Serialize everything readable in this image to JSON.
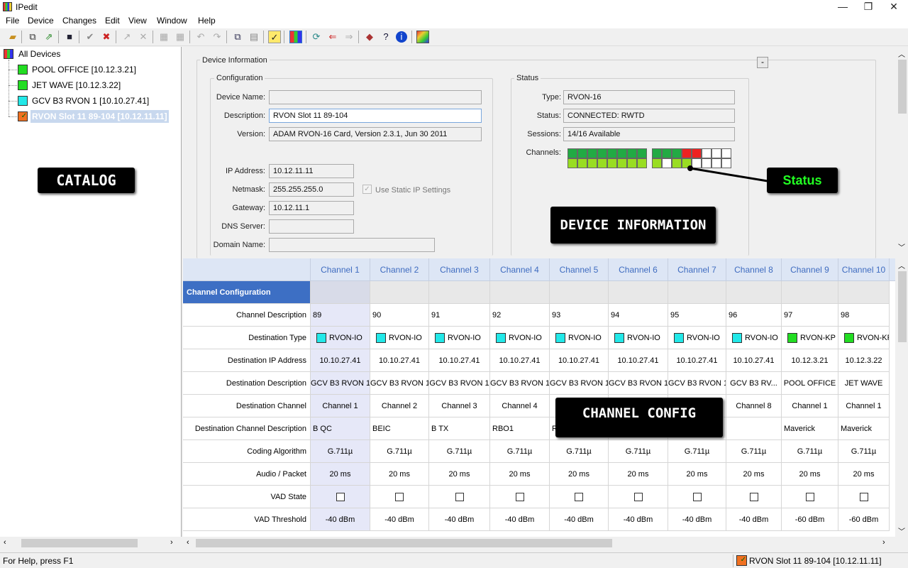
{
  "window": {
    "title": "IPedit",
    "minimize": "—",
    "restore": "❐",
    "close": "✕"
  },
  "menu": [
    "File",
    "Device",
    "Changes",
    "Edit",
    "View",
    "Window",
    "Help"
  ],
  "toolbar_icons": [
    "open-folder-icon",
    "copy-device-icon",
    "export-icon",
    "save-icon",
    "apply-icon",
    "cancel-changes-icon",
    "connect-icon",
    "disconnect-icon",
    "grid-a-icon",
    "grid-b-icon",
    "undo-icon",
    "redo-icon",
    "copy-icon",
    "paste-icon",
    "check-icon",
    "channel-grid-icon",
    "refresh-icon",
    "back-icon",
    "forward-icon",
    "book-icon",
    "help-cursor-icon",
    "info-icon",
    "palette-icon"
  ],
  "tree": {
    "root": "All Devices",
    "items": [
      {
        "label": "POOL OFFICE [10.12.3.21]",
        "color": "#22dd22"
      },
      {
        "label": "JET WAVE [10.12.3.22]",
        "color": "#22dd22"
      },
      {
        "label": "GCV B3 RVON 1 [10.10.27.41]",
        "color": "#22e8e8"
      },
      {
        "label": "RVON Slot 11  89-104 [10.12.11.11]",
        "color": "#f07020",
        "selected": true
      }
    ]
  },
  "callouts": {
    "catalog": "CATALOG",
    "device_info": "DEVICE INFORMATION",
    "status": "Status",
    "channel_config": "CHANNEL CONFIG"
  },
  "device_info": {
    "title": "Device Information",
    "collapse_btn": "-",
    "configuration": {
      "title": "Configuration",
      "device_name_label": "Device Name:",
      "device_name": "",
      "description_label": "Description:",
      "description": "RVON Slot 11  89-104",
      "version_label": "Version:",
      "version": "ADAM RVON-16 Card, Version 2.3.1, Jun 30 2011",
      "ip_label": "IP Address:",
      "ip": "10.12.11.11",
      "netmask_label": "Netmask:",
      "netmask": "255.255.255.0",
      "static_ip_label": "Use Static IP Settings",
      "gateway_label": "Gateway:",
      "gateway": "10.12.11.1",
      "dns_label": "DNS Server:",
      "dns": "",
      "domain_label": "Domain Name:",
      "domain": ""
    },
    "status": {
      "title": "Status",
      "type_label": "Type:",
      "type": "RVON-16",
      "status_label": "Status:",
      "status": "CONNECTED: RWTD",
      "sessions_label": "Sessions:",
      "sessions": "14/16 Available",
      "channels_label": "Channels:",
      "channels_top": [
        "#22aa44",
        "#22aa44",
        "#22aa44",
        "#22aa44",
        "#22aa44",
        "#22aa44",
        "#22aa44",
        "#22aa44",
        "#22aa44",
        "#22aa44",
        "#22aa44",
        "#ee2222",
        "#ee2222",
        "#ffffff",
        "#ffffff",
        "#ffffff",
        "#ffffff",
        "#ffffff",
        "#ffffff"
      ],
      "channels_bottom": [
        "#99dd22",
        "#99dd22",
        "#99dd22",
        "#99dd22",
        "#99dd22",
        "#99dd22",
        "#99dd22",
        "#99dd22",
        "#99dd22",
        "#ffffff",
        "#99dd22",
        "#99dd22",
        "#ffffff",
        "#ffffff",
        "#ffffff",
        "#ffffff",
        "#ffffff",
        "#ffffff",
        "#ffffff"
      ]
    }
  },
  "grid": {
    "section_label": "Channel Configuration",
    "columns": [
      "Channel 1",
      "Channel 2",
      "Channel 3",
      "Channel 4",
      "Channel 5",
      "Channel 6",
      "Channel 7",
      "Channel 8",
      "Channel 9",
      "Channel 10"
    ],
    "rows": [
      {
        "label": "Channel Description",
        "align": "l",
        "values": [
          "89",
          "90",
          "91",
          "92",
          "93",
          "94",
          "95",
          "96",
          "97",
          "98"
        ]
      },
      {
        "label": "Destination Type",
        "type": "dest",
        "values": [
          "RVON-IO",
          "RVON-IO",
          "RVON-IO",
          "RVON-IO",
          "RVON-IO",
          "RVON-IO",
          "RVON-IO",
          "RVON-IO",
          "RVON-KP",
          "RVON-KP"
        ],
        "colors": [
          "#22e8e8",
          "#22e8e8",
          "#22e8e8",
          "#22e8e8",
          "#22e8e8",
          "#22e8e8",
          "#22e8e8",
          "#22e8e8",
          "#22dd22",
          "#22dd22"
        ]
      },
      {
        "label": "Destination IP Address",
        "align": "c",
        "values": [
          "10.10.27.41",
          "10.10.27.41",
          "10.10.27.41",
          "10.10.27.41",
          "10.10.27.41",
          "10.10.27.41",
          "10.10.27.41",
          "10.10.27.41",
          "10.12.3.21",
          "10.12.3.22"
        ]
      },
      {
        "label": "Destination Description",
        "align": "c",
        "values": [
          "GCV B3 RVON 1",
          "GCV B3 RVON 1",
          "GCV B3 RVON 1",
          "GCV B3 RVON 1",
          "GCV B3 RVON 1",
          "GCV B3 RVON 1",
          "GCV B3 RVON 1",
          "GCV B3 RV...",
          "POOL OFFICE",
          "JET WAVE"
        ]
      },
      {
        "label": "Destination Channel",
        "align": "c",
        "values": [
          "Channel 1",
          "Channel 2",
          "Channel 3",
          "Channel 4",
          "",
          "",
          "",
          "Channel 8",
          "Channel 1",
          "Channel 1"
        ]
      },
      {
        "label": "Destination Channel Description",
        "align": "l",
        "values": [
          "B QC",
          "BEIC",
          "B TX",
          "RBO1",
          "R",
          "",
          "",
          "",
          "Maverick",
          "Maverick"
        ]
      },
      {
        "label": "Coding Algorithm",
        "align": "c",
        "values": [
          "G.711µ",
          "G.711µ",
          "G.711µ",
          "G.711µ",
          "G.711µ",
          "G.711µ",
          "G.711µ",
          "G.711µ",
          "G.711µ",
          "G.711µ"
        ]
      },
      {
        "label": "Audio / Packet",
        "align": "c",
        "values": [
          "20 ms",
          "20 ms",
          "20 ms",
          "20 ms",
          "20 ms",
          "20 ms",
          "20 ms",
          "20 ms",
          "20 ms",
          "20 ms"
        ]
      },
      {
        "label": "VAD State",
        "type": "check",
        "values": [
          false,
          false,
          false,
          false,
          false,
          false,
          false,
          false,
          false,
          false
        ]
      },
      {
        "label": "VAD Threshold",
        "align": "c",
        "values": [
          "-40 dBm",
          "-40 dBm",
          "-40 dBm",
          "-40 dBm",
          "-40 dBm",
          "-40 dBm",
          "-40 dBm",
          "-40 dBm",
          "-60 dBm",
          "-60 dBm"
        ]
      }
    ]
  },
  "statusbar": {
    "help": "For Help, press F1",
    "device": "RVON Slot 11  89-104 [10.12.11.11]"
  }
}
